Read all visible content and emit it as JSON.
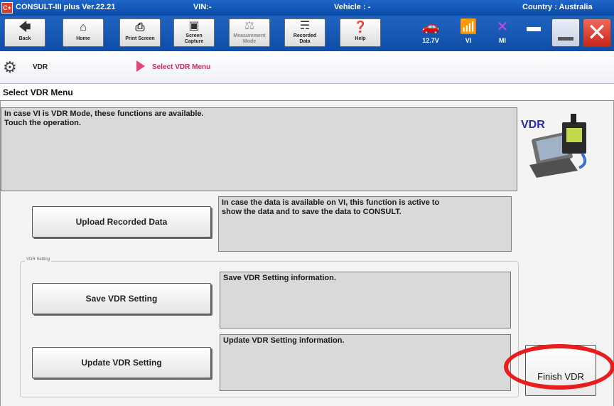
{
  "titlebar": {
    "app": "CONSULT-III plus  Ver.22.21",
    "vin": "VIN:-",
    "vehicle": "Vehicle : -",
    "country": "Country : Australia"
  },
  "toolbar": {
    "back": "Back",
    "home": "Home",
    "print_screen": "Print Screen",
    "screen_capture_1": "Screen",
    "screen_capture_2": "Capture",
    "measurement_1": "Measurement",
    "measurement_2": "Mode",
    "recorded_1": "Recorded",
    "recorded_2": "Data",
    "help": "Help",
    "battery": "12.7V",
    "vi": "VI",
    "mi": "MI"
  },
  "breadcrumb": {
    "root": "VDR",
    "current": "Select VDR Menu"
  },
  "page": {
    "title": "Select VDR Menu"
  },
  "main": {
    "intro_line1": "In case VI is VDR Mode, these functions are available.",
    "intro_line2": "Touch the operation.",
    "upload_button": "Upload Recorded Data",
    "upload_desc_line1": "In case the data is available on VI, this function is active to",
    "upload_desc_line2": "show the data and to save the data to CONSULT.",
    "group_label": "VDR Setting",
    "save_button": "Save VDR Setting",
    "save_desc": "Save VDR Setting information.",
    "update_button": "Update VDR Setting",
    "update_desc": "Update VDR Setting information.",
    "finish_button": "Finish VDR",
    "vdr_logo_text": "VDR"
  },
  "colors": {
    "titlebar": "#0b4aa8",
    "crumb_current": "#d4265c",
    "highlight_ring": "#e81d1d",
    "info_box": "#d9d9d9"
  }
}
